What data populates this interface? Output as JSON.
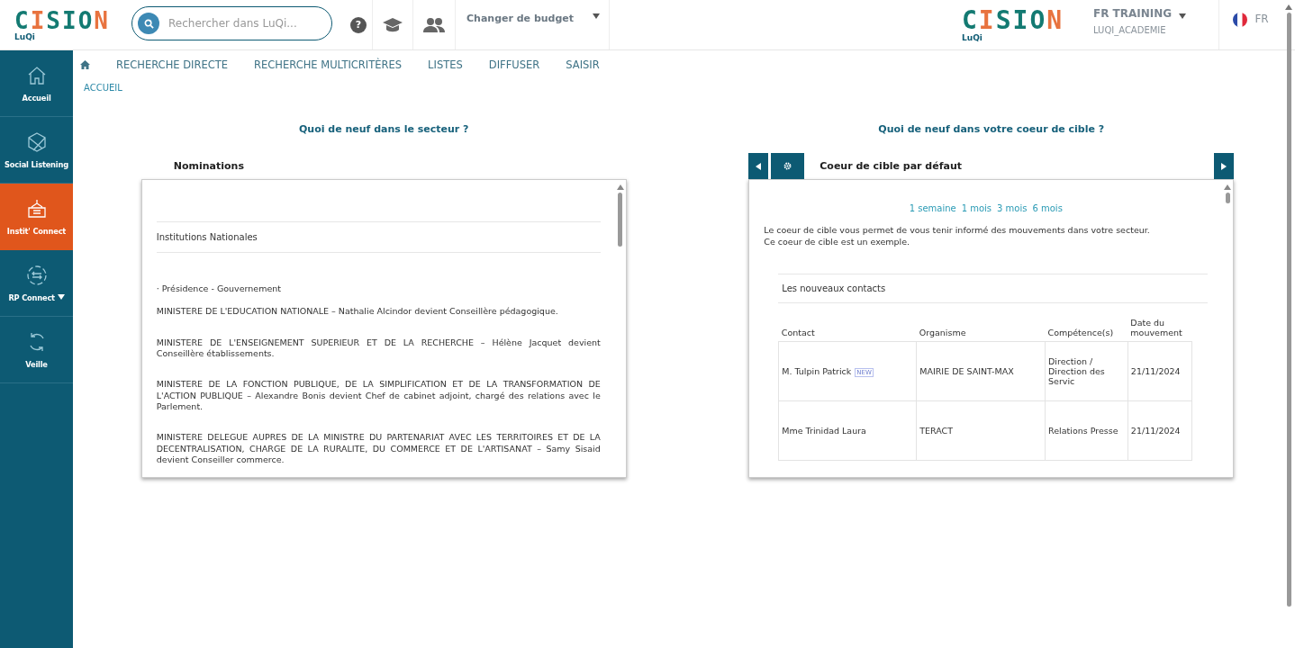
{
  "header": {
    "logo": {
      "word": "CISION",
      "sub": "LuQi"
    },
    "search": {
      "placeholder": "Rechercher dans LuQi..."
    },
    "help": "?",
    "budget": "Changer de budget",
    "brand": {
      "word": "CISION",
      "sub": "LuQi"
    },
    "account": {
      "name": "FR TRAINING",
      "org": "LUQI_ACADEMIE"
    },
    "language": "FR"
  },
  "sidebar": {
    "items": [
      {
        "label": "Accueil",
        "selected": false,
        "dropdown": false
      },
      {
        "label": "Social Listening",
        "selected": false,
        "dropdown": false
      },
      {
        "label": "Instit' Connect",
        "selected": true,
        "dropdown": false
      },
      {
        "label": "RP Connect",
        "selected": false,
        "dropdown": true
      },
      {
        "label": "Veille",
        "selected": false,
        "dropdown": false
      }
    ]
  },
  "nav": {
    "items": [
      "RECHERCHE DIRECTE",
      "RECHERCHE MULTICRITÈRES",
      "LISTES",
      "DIFFUSER",
      "SAISIR"
    ],
    "breadcrumb": "ACCUEIL"
  },
  "left_panel": {
    "heading": "Quoi de neuf dans le secteur ?",
    "tab": "Nominations",
    "section": "Institutions Nationales",
    "entries": [
      {
        "kind": "category",
        "text": "· Présidence - Gouvernement"
      },
      {
        "kind": "entry",
        "text": "MINISTERE DE L'EDUCATION NATIONALE – Nathalie Alcindor devient Conseillère pédagogique."
      },
      {
        "kind": "entry",
        "text": "MINISTERE DE L'ENSEIGNEMENT SUPERIEUR ET DE LA RECHERCHE – Hélène Jacquet devient Conseillère établissements."
      },
      {
        "kind": "entry",
        "text": "MINISTERE DE LA FONCTION PUBLIQUE, DE LA SIMPLIFICATION ET DE LA TRANSFORMATION DE L'ACTION PUBLIQUE – Alexandre Bonis devient Chef de cabinet adjoint, chargé des relations avec le Parlement."
      },
      {
        "kind": "entry",
        "text": "MINISTERE DELEGUE AUPRES DE LA MINISTRE DU PARTENARIAT AVEC LES TERRITOIRES ET DE LA DECENTRALISATION, CHARGE DE LA RURALITE, DU COMMERCE ET DE L'ARTISANAT – Samy Sisaid devient Conseiller commerce."
      }
    ]
  },
  "right_panel": {
    "heading": "Quoi de neuf dans votre coeur de cible ?",
    "tab": "Coeur de cible par défaut",
    "periods": [
      "1 semaine",
      "1 mois",
      "3 mois",
      "6 mois"
    ],
    "description": [
      "Le coeur de cible vous permet de vous tenir informé des mouvements dans votre secteur.",
      "Ce coeur de cible est un exemple."
    ],
    "table": {
      "title": "Les nouveaux contacts",
      "columns": [
        "Contact",
        "Organisme",
        "Compétence(s)",
        "Date du mouvement"
      ],
      "rows": [
        {
          "contact": "M.  Tulpin Patrick",
          "badge": "NEW",
          "organisme": "MAIRIE DE SAINT-MAX",
          "competence": "Direction / Direction des Servic",
          "date": "21/11/2024"
        },
        {
          "contact": "Mme  Trinidad Laura",
          "organisme": "TERACT",
          "competence": "Relations Presse",
          "date": "21/11/2024"
        }
      ]
    }
  }
}
